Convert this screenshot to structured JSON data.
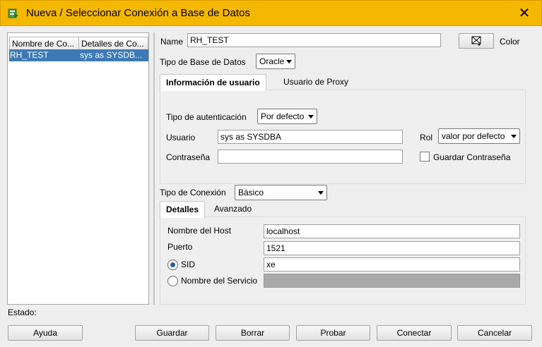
{
  "window": {
    "title": "Nueva / Seleccionar Conexión a Base de Datos",
    "close_glyph": "✕"
  },
  "connections": {
    "columns": [
      "Nombre de Co...",
      "Detalles de Co..."
    ],
    "rows": [
      {
        "name": "RH_TEST",
        "details": "sys as SYSDB..."
      }
    ]
  },
  "form": {
    "name_label": "Name",
    "name_value": "RH_TEST",
    "color_label": "Color",
    "db_type_label": "Tipo de Base de Datos",
    "db_type_value": "Oracle",
    "user_tabs": [
      "Información de usuario",
      "Usuario de Proxy"
    ],
    "auth_type_label": "Tipo de autenticación",
    "auth_type_value": "Por defecto",
    "user_label": "Usuario",
    "user_value": "sys as SYSDBA",
    "role_label": "Rol",
    "role_value": "valor por defecto",
    "password_label": "Contraseña",
    "password_value": "",
    "save_password_label": "Guardar Contraseña",
    "save_password_checked": false,
    "conn_type_label": "Tipo de Conexión",
    "conn_type_value": "Básico",
    "conn_tabs": [
      "Detalles",
      "Avanzado"
    ],
    "host_label": "Nombre del Host",
    "host_value": "localhost",
    "port_label": "Puerto",
    "port_value": "1521",
    "sid_label": "SID",
    "sid_value": "xe",
    "service_label": "Nombre del Servicio",
    "service_value": ""
  },
  "status": {
    "label": "Estado:"
  },
  "buttons": {
    "help": "Ayuda",
    "save": "Guardar",
    "delete": "Borrar",
    "test": "Probar",
    "connect": "Conectar",
    "cancel": "Cancelar"
  },
  "colors": {
    "titlebar": "#f5b800",
    "selection": "#3d7ab5"
  }
}
